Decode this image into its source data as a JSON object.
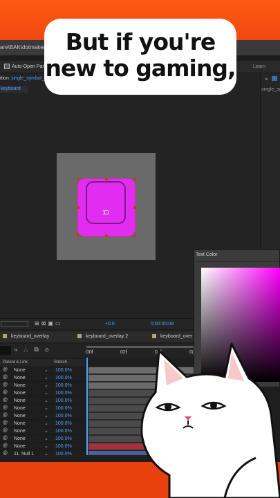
{
  "caption": {
    "line1": "But if you're",
    "line2": "new to gaming,"
  },
  "app": {
    "path_fragment": "are\\BAK\\dotmaker_",
    "auto_open_label": "Auto-Open Pan",
    "learn_label": "Learn",
    "right_panel_label": "single_sy"
  },
  "composition": {
    "tab_prefix": "ition",
    "tab_name": "single_symbol_",
    "sub_label": "keyboard",
    "center_glyph": "1"
  },
  "viewer": {
    "exposure": "+0.0",
    "timecode": "0:00:00:08"
  },
  "timeline": {
    "tabs": [
      "keyboard_overlay",
      "keyboard_overlay 2",
      "keyboard_over"
    ],
    "ruler": [
      ":00f",
      "02f",
      "04f",
      "0("
    ],
    "columns": {
      "parent": "Parent & Link",
      "stretch": "Stretch"
    },
    "rows": [
      {
        "parent": "None",
        "stretch": "100.0%"
      },
      {
        "parent": "None",
        "stretch": "100.0%"
      },
      {
        "parent": "None",
        "stretch": "100.0%"
      },
      {
        "parent": "None",
        "stretch": "100.0%"
      },
      {
        "parent": "None",
        "stretch": "100.0%"
      },
      {
        "parent": "None",
        "stretch": "100.0%"
      },
      {
        "parent": "None",
        "stretch": "100.0%"
      },
      {
        "parent": "None",
        "stretch": "100.0%"
      },
      {
        "parent": "None",
        "stretch": "100.0%"
      },
      {
        "parent": "None",
        "stretch": "100.0%"
      },
      {
        "parent": "None",
        "stretch": "100.0%"
      },
      {
        "parent": "11. Null 1",
        "stretch": "100.0%"
      }
    ]
  },
  "color_picker": {
    "title": "Text Color",
    "selected_hue": "#ff00ff"
  },
  "colors": {
    "accent_orange": "#f04810",
    "key_magenta": "#e22cf0",
    "ae_blue": "#4aa3ff"
  }
}
